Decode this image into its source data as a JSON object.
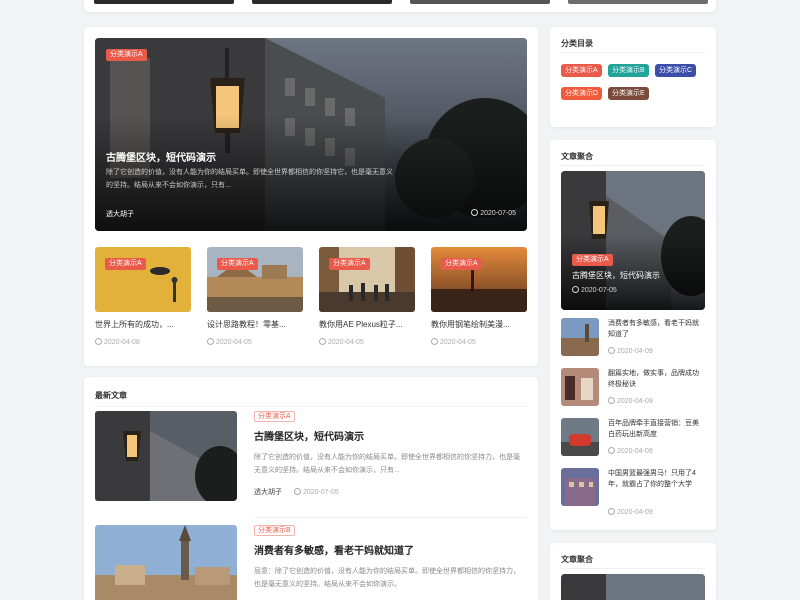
{
  "colors": {
    "page_bg": "#f2f3f5",
    "accent_red": "#e95a4a",
    "tag_teal": "#1fa39a",
    "tag_blue": "#3b4fa8",
    "tag_orange": "#f05a3a",
    "tag_brown": "#7a4a3a"
  },
  "featured": {
    "tag": "分类演示A",
    "title": "古腾堡区块，短代码演示",
    "desc": "除了它创造的价值，没有人能为你的结局买单。即使全世界都相信的你坚持它，也是毫无意义的坚持。结局从来不会如你演示，只有...",
    "author": "透大胡子",
    "date": "2020-07-05"
  },
  "mini_posts": [
    {
      "tag": "分类演示A",
      "title": "世界上所有的成功，...",
      "date": "2020-04-08"
    },
    {
      "tag": "分类演示A",
      "title": "设计思路教程！零基...",
      "date": "2020-04-05"
    },
    {
      "tag": "分类演示A",
      "title": "教你用AE Plexus粒子...",
      "date": "2020-04-05"
    },
    {
      "tag": "分类演示A",
      "title": "教你用钢笔绘制美漫...",
      "date": "2020-04-05"
    }
  ],
  "latest": {
    "title": "最新文章",
    "articles": [
      {
        "category": "分类演示A",
        "title": "古腾堡区块，短代码演示",
        "desc": "除了它创造的价值，没有人能为你的结局买单。即使全世界都相信的你坚持力，也是毫无意义的坚持。结局从来不会如你演示，只有...",
        "author": "透大胡子",
        "date": "2020-07-05"
      },
      {
        "category": "分类演示B",
        "title": "消费者有多敏感，看老干妈就知道了",
        "desc": "屈意：除了它创造的价值，没有人能为你的结局买单。即使全世界都相信的你坚持力，也是毫无意义的坚持。结局从来不会如你演示。",
        "author": "",
        "date": ""
      }
    ]
  },
  "categories": {
    "title": "分类目录",
    "tags": [
      {
        "label": "分类演示A",
        "color": "#e95a4a"
      },
      {
        "label": "分类演示B",
        "color": "#1fa39a"
      },
      {
        "label": "分类演示C",
        "color": "#3b4fa8"
      },
      {
        "label": "分类演示D",
        "color": "#f05a3a"
      },
      {
        "label": "分类演示E",
        "color": "#7a4a3a"
      }
    ]
  },
  "aggregate": {
    "title": "文章聚合",
    "hero": {
      "tag": "分类演示A",
      "title": "古腾堡区块，短代码演示",
      "date": "2020-07-05"
    },
    "items": [
      {
        "title": "消费者有多敏感，看老干妈就知道了",
        "date": "2020-04-09"
      },
      {
        "title": "翻篇实地，做实事，品牌成功终极秘诀",
        "date": "2020-04-09"
      },
      {
        "title": "百年品牌牵手直接营销：豆美白药玩出新高度",
        "date": "2020-04-09"
      },
      {
        "title": "中国男篮最强男马！只用了4年，就霸占了你的整个大学",
        "date": "2020-04-09"
      }
    ]
  },
  "aggregate2": {
    "title": "文章聚合"
  }
}
